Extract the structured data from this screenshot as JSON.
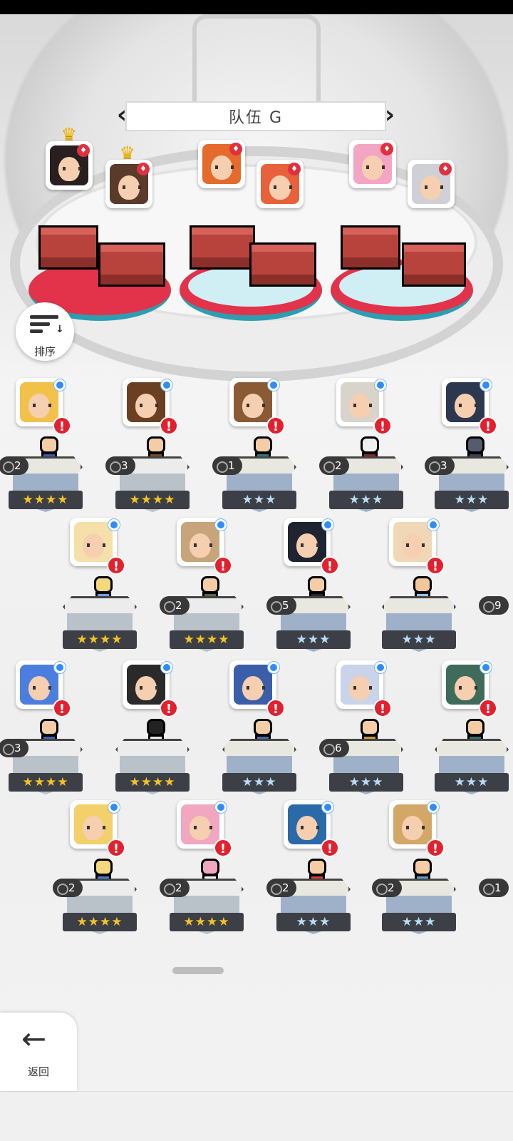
{
  "team": {
    "name": "队伍 G"
  },
  "sort": {
    "label": "排序"
  },
  "back": {
    "label": "返回"
  },
  "colors": {
    "alert": "#e3202e",
    "owned_dot": "#2d8cff",
    "star_gold": "#f5c226",
    "star_blue": "#b8dcf5",
    "platform_red": "#e2334a"
  },
  "rows": [
    [
      {
        "stars": "★★★★",
        "count": "2",
        "star_color": "gold"
      },
      {
        "stars": "★★★★",
        "count": "3",
        "star_color": "gold"
      },
      {
        "stars": "★★★",
        "count": "1",
        "star_color": "blue"
      },
      {
        "stars": "★★★",
        "count": "2",
        "star_color": "blue"
      },
      {
        "stars": "★★★",
        "count": "3",
        "star_color": "blue"
      }
    ],
    [
      {
        "stars": "★★★★",
        "count": "",
        "star_color": "gold"
      },
      {
        "stars": "★★★★",
        "count": "2",
        "star_color": "gold"
      },
      {
        "stars": "★★★",
        "count": "5",
        "star_color": "blue"
      },
      {
        "stars": "★★★",
        "count": "",
        "star_color": "blue"
      },
      {
        "stars": "",
        "count": "9",
        "star_color": "blue"
      }
    ],
    [
      {
        "stars": "★★★★",
        "count": "3",
        "star_color": "gold"
      },
      {
        "stars": "★★★★",
        "count": "",
        "star_color": "gold"
      },
      {
        "stars": "★★★",
        "count": "",
        "star_color": "blue"
      },
      {
        "stars": "★★★",
        "count": "6",
        "star_color": "blue"
      },
      {
        "stars": "★★★",
        "count": "",
        "star_color": "blue"
      }
    ],
    [
      {
        "stars": "★★★★",
        "count": "2",
        "star_color": "gold"
      },
      {
        "stars": "★★★★",
        "count": "2",
        "star_color": "gold"
      },
      {
        "stars": "★★★",
        "count": "2",
        "star_color": "blue"
      },
      {
        "stars": "★★★",
        "count": "2",
        "star_color": "blue"
      },
      {
        "stars": "",
        "count": "1",
        "star_color": "blue"
      }
    ]
  ]
}
